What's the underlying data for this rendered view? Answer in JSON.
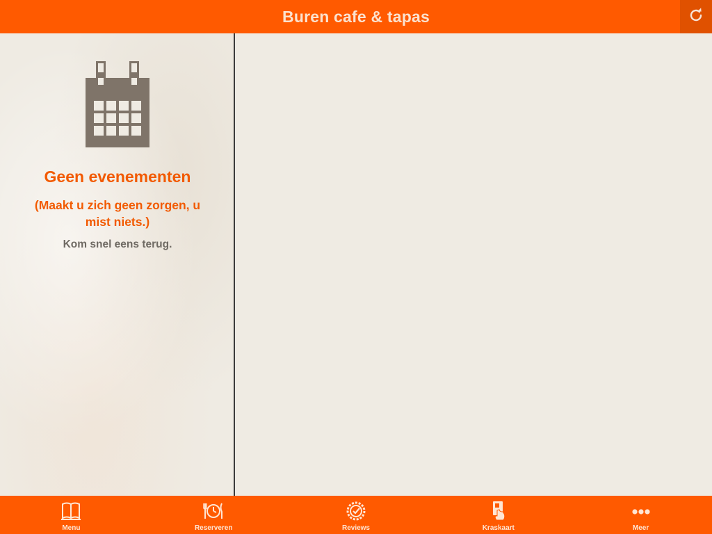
{
  "header": {
    "title": "Buren cafe & tapas",
    "refresh_icon": "refresh-icon"
  },
  "events": {
    "icon": "calendar-icon",
    "title": "Geen evenementen",
    "subtitle": "(Maakt u zich geen zorgen, u mist niets.)",
    "hint": "Kom snel eens terug."
  },
  "nav": {
    "items": [
      {
        "label": "Menu",
        "icon": "book-icon"
      },
      {
        "label": "Reserveren",
        "icon": "plate-clock-icon"
      },
      {
        "label": "Reviews",
        "icon": "badge-check-icon"
      },
      {
        "label": "Kraskaart",
        "icon": "scratch-card-icon"
      },
      {
        "label": "Meer",
        "icon": "more-dots-icon"
      }
    ]
  },
  "colors": {
    "brand_orange": "#ff5a00",
    "accent_text": "#f25a00",
    "icon_brown": "#7f7469",
    "background": "#efebe3"
  }
}
